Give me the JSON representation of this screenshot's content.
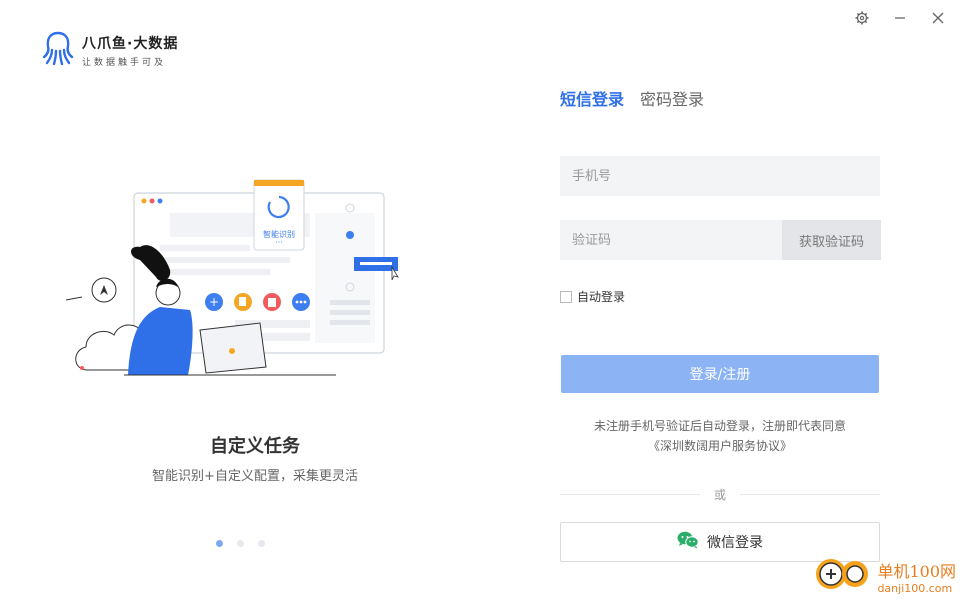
{
  "window": {
    "settings_icon": "gear-icon",
    "minimize_icon": "minimize-icon",
    "close_icon": "close-icon"
  },
  "brand": {
    "name": "八爪鱼·大数据",
    "slogan": "让数据触手可及",
    "icon": "octopus-logo-icon"
  },
  "carousel": {
    "illustration_text": "智能识别",
    "illustration_dots": "···",
    "title": "自定义任务",
    "subtitle": "智能识别+自定义配置，采集更灵活",
    "slides": 3,
    "active_slide": 1
  },
  "login": {
    "tabs": [
      {
        "label": "短信登录",
        "active": true
      },
      {
        "label": "密码登录",
        "active": false
      }
    ],
    "phone_placeholder": "手机号",
    "code_placeholder": "验证码",
    "get_code_label": "获取验证码",
    "auto_login_label": "自动登录",
    "submit_label": "登录/注册",
    "notice_line1": "未注册手机号验证后自动登录，注册即代表同意",
    "notice_line2": "《深圳数阔用户服务协议》",
    "or_label": "或",
    "wechat_label": "微信登录",
    "colors": {
      "accent": "#2f6fe8",
      "button": "#8cb4f5",
      "wechat": "#2aae67"
    }
  },
  "watermark": {
    "line1": "单机100网",
    "line2": "danji100.com"
  }
}
